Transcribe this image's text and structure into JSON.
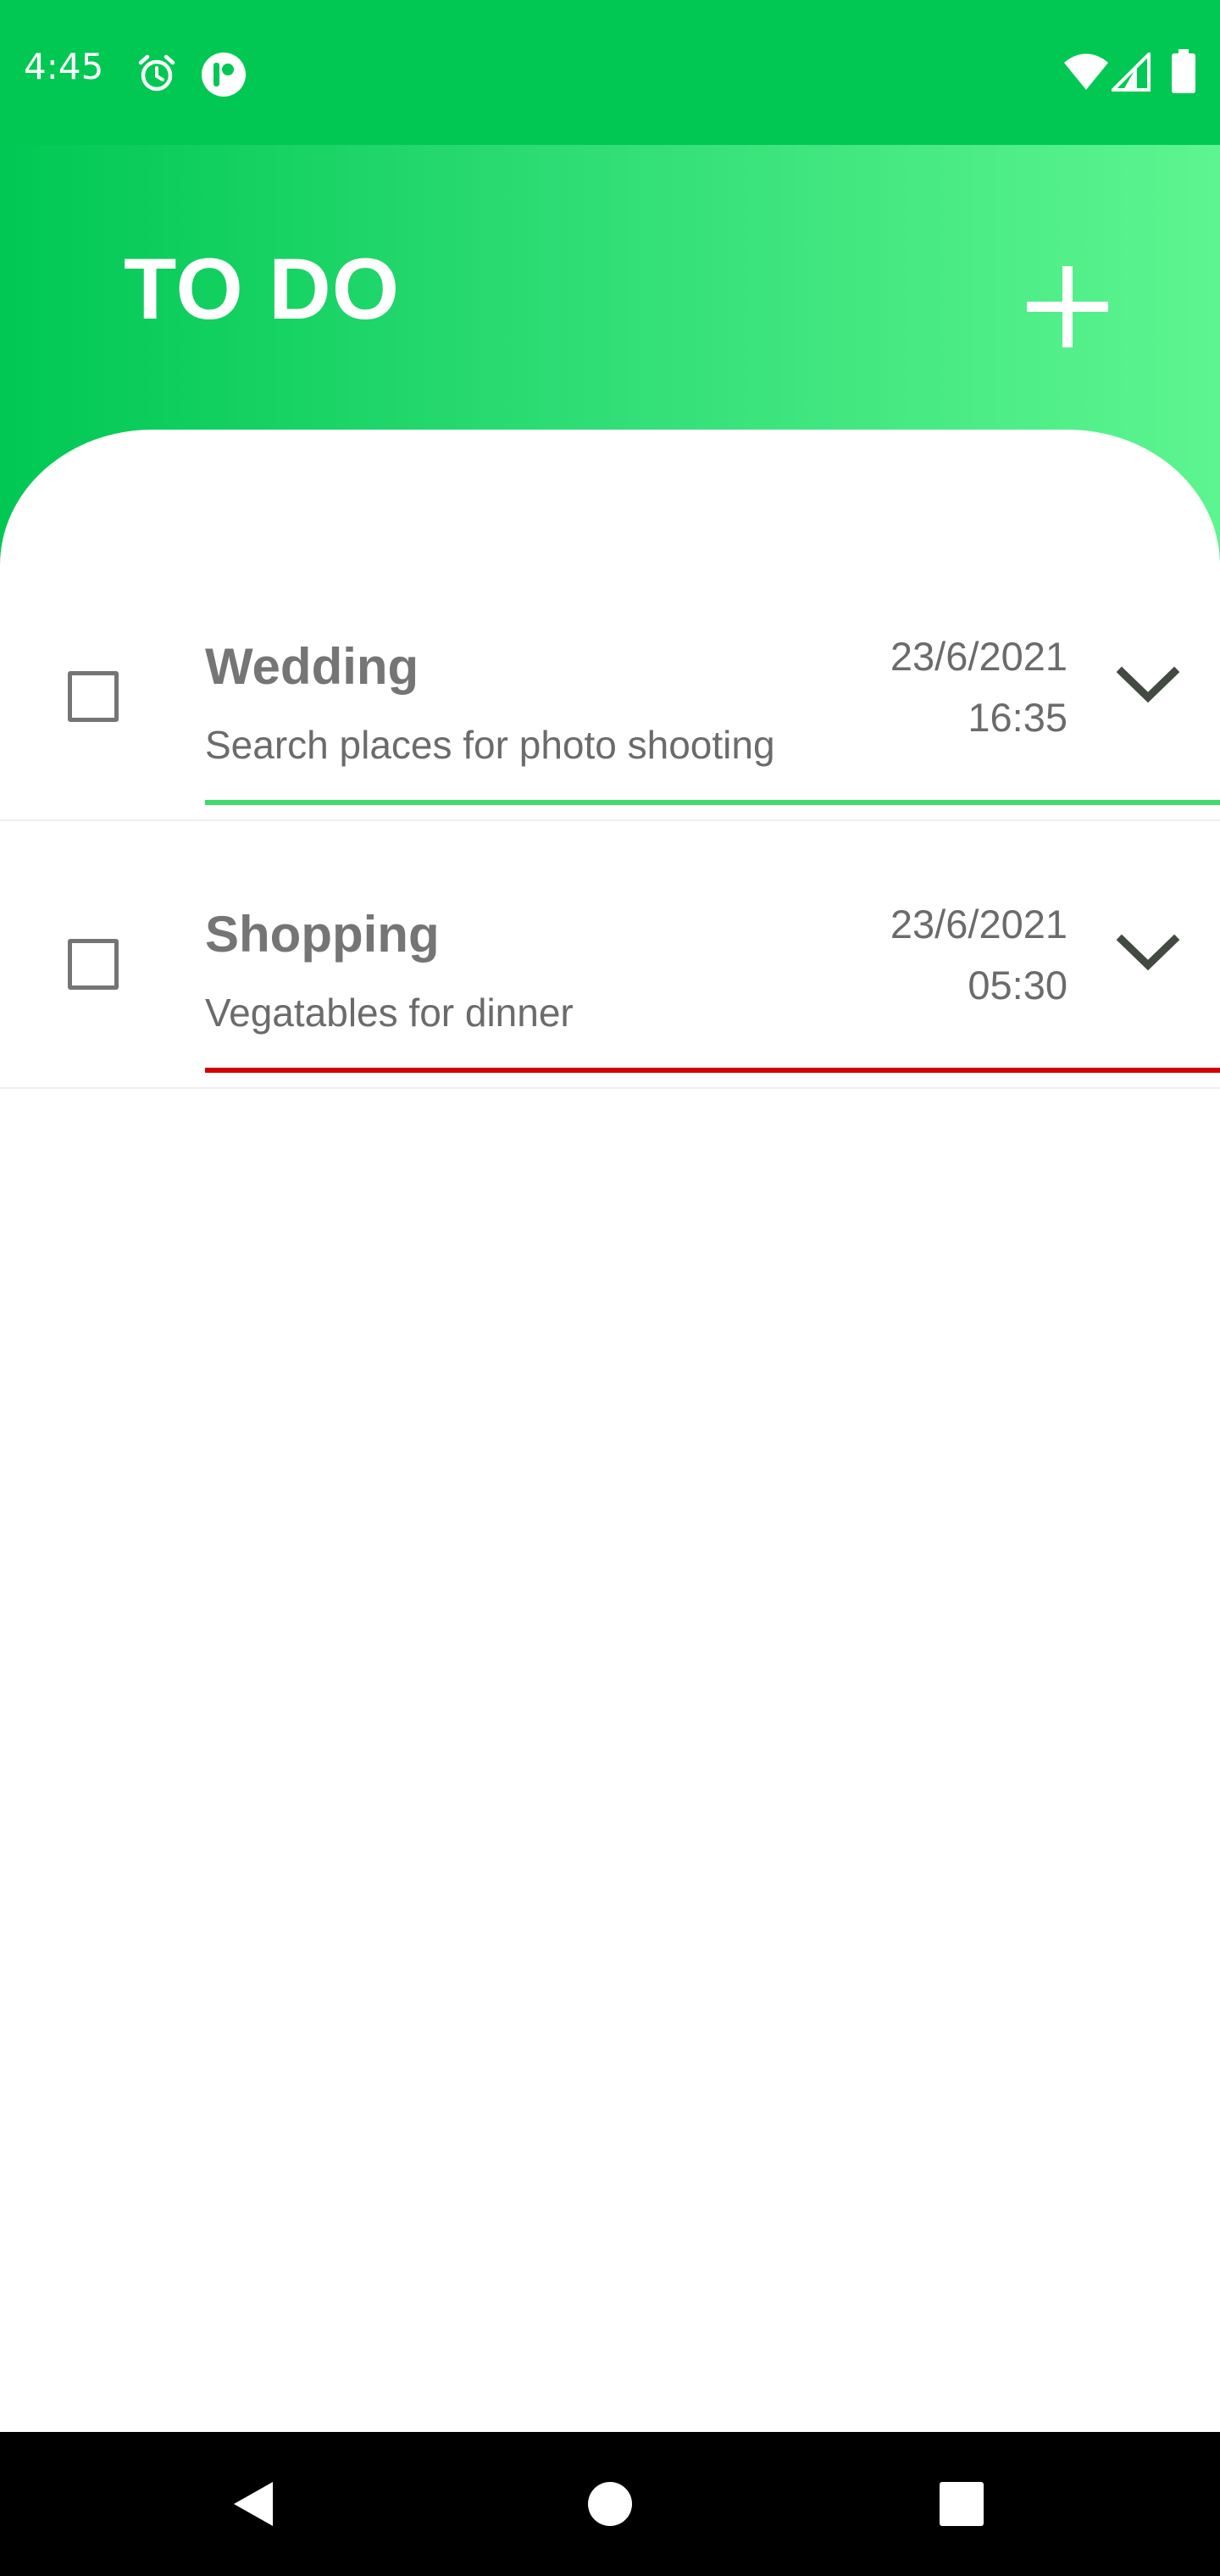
{
  "status_bar": {
    "time": "4:45",
    "icons": [
      "alarm-icon",
      "app-notification-icon",
      "wifi-icon",
      "signal-icon",
      "battery-icon"
    ],
    "background": "#00c853"
  },
  "header": {
    "title": "TO DO",
    "add_icon": "plus-icon",
    "gradient": [
      "#00c853",
      "#5df590"
    ]
  },
  "todos": [
    {
      "title": "Wedding",
      "description": "Search places for photo shooting",
      "date": "23/6/2021",
      "time": "16:35",
      "checked": false,
      "priority_color": "#3ddc6a"
    },
    {
      "title": "Shopping",
      "description": "Vegatables for dinner",
      "date": "23/6/2021",
      "time": "05:30",
      "checked": false,
      "priority_color": "#d50000"
    }
  ],
  "nav_bar": {
    "buttons": [
      "back-icon",
      "home-icon",
      "recents-icon"
    ]
  }
}
